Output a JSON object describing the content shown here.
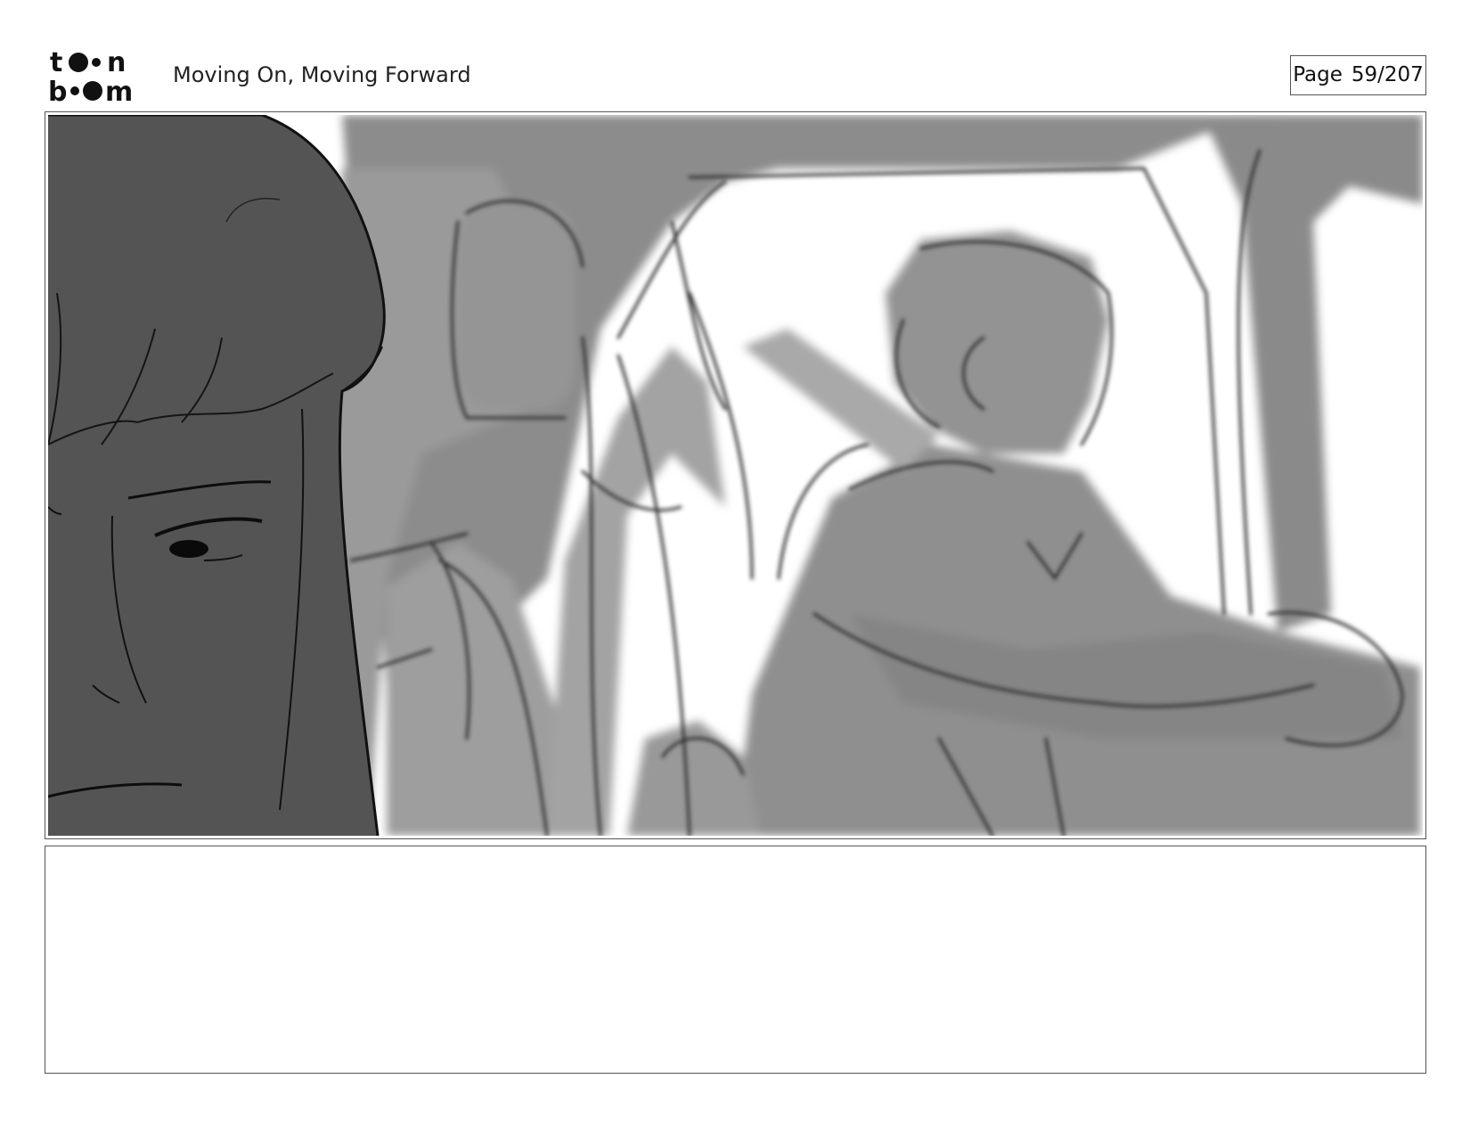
{
  "header": {
    "logo_text": "toonboom",
    "title": "Moving On, Moving Forward",
    "page_label": "Page",
    "page_number": "59/207"
  },
  "panel": {
    "icon": "storyboard-sketch-car-interior"
  },
  "notes": {
    "text": ""
  }
}
